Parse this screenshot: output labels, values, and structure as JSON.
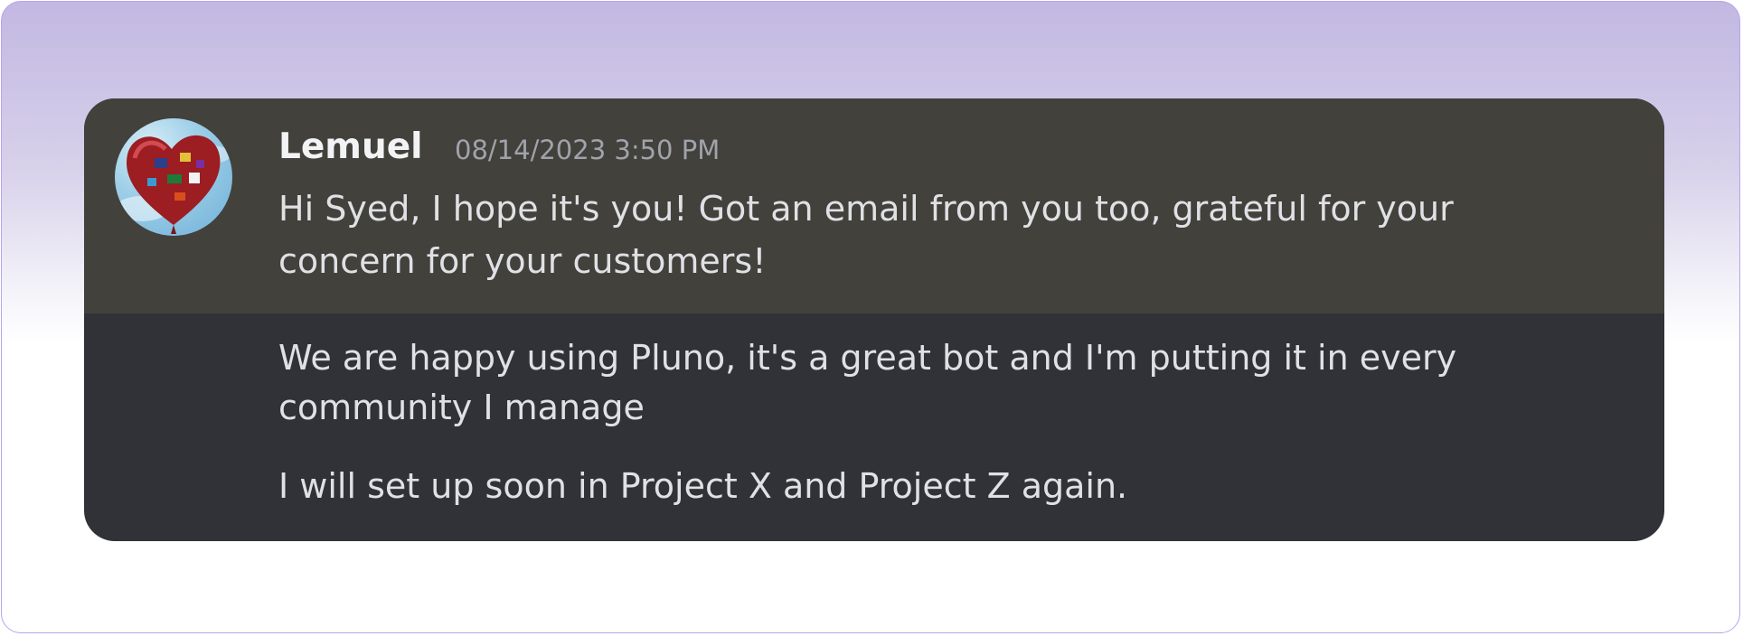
{
  "message": {
    "author": "Lemuel",
    "timestamp": "08/14/2023 3:50 PM",
    "avatar_icon": "heart-balloon-avatar",
    "lines": [
      "Hi Syed, I hope it's you! Got an email from you too, grateful for your",
      "concern for your customers!",
      "We are happy using Pluno, it's a great bot and I'm putting it in every",
      "community I manage",
      "I will set up soon in Project X and Project Z again."
    ]
  },
  "colors": {
    "highlight_bg": "#43413c",
    "card_bg": "#313238",
    "border_accent": "#b8a4ee"
  }
}
